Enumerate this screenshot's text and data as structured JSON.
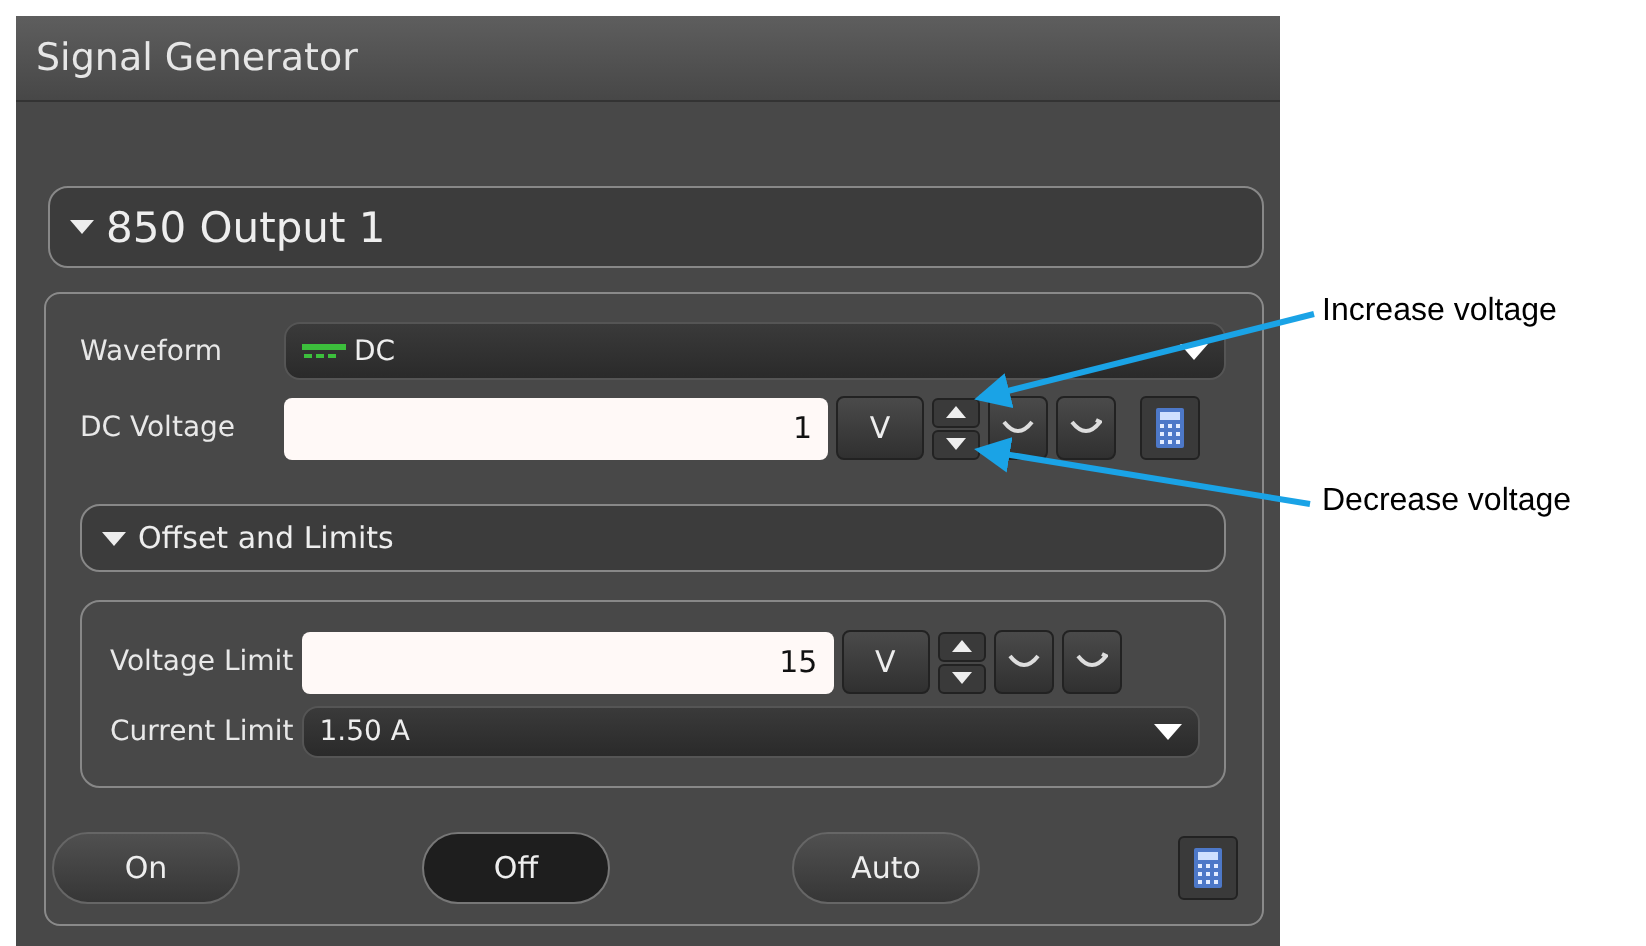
{
  "window": {
    "title": "Signal Generator"
  },
  "output_section": {
    "title": "850 Output 1",
    "expanded": true
  },
  "waveform": {
    "label": "Waveform",
    "value": "DC"
  },
  "dc_voltage": {
    "label": "DC Voltage",
    "value": "1",
    "unit": "V"
  },
  "offset_section": {
    "title": "Offset and Limits",
    "expanded": true
  },
  "voltage_limit": {
    "label": "Voltage Limit",
    "value": "15",
    "unit": "V"
  },
  "current_limit": {
    "label": "Current Limit",
    "value": "1.50 A"
  },
  "buttons": [
    {
      "label": "On",
      "selected": false
    },
    {
      "label": "Off",
      "selected": true
    },
    {
      "label": "Auto",
      "selected": false
    }
  ],
  "annotations": [
    {
      "text": "Increase voltage"
    },
    {
      "text": "Decrease voltage"
    }
  ]
}
